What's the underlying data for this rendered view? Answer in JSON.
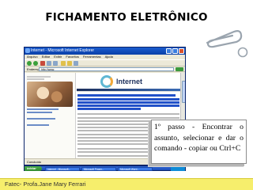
{
  "slide": {
    "title": "FICHAMENTO ELETRÔNICO",
    "footer": "Fatec- Profa.Jane Mary Ferrari",
    "callout": "1º passo - Encontrar o assunto, selecionar e dar o comando - copiar ou Ctrl+C"
  },
  "browser": {
    "window_title": "Internet - Microsoft Internet Explorer",
    "menu": [
      "Arquivo",
      "Editar",
      "Exibir",
      "Favoritos",
      "Ferramentas",
      "Ajuda"
    ],
    "address_label": "Endereço",
    "address_value": "http://www.",
    "banner_title": "Internet",
    "status_text": "Concluído"
  },
  "taskbar": {
    "start_label": "iniciar",
    "tasks": [
      "Internet - Microsoft...",
      "Microsoft Power...",
      "Microsoft Word..."
    ]
  },
  "colors": {
    "footer": "#f6ee6c",
    "selection": "#2251c8",
    "titlebar": "#0a3fa8"
  }
}
